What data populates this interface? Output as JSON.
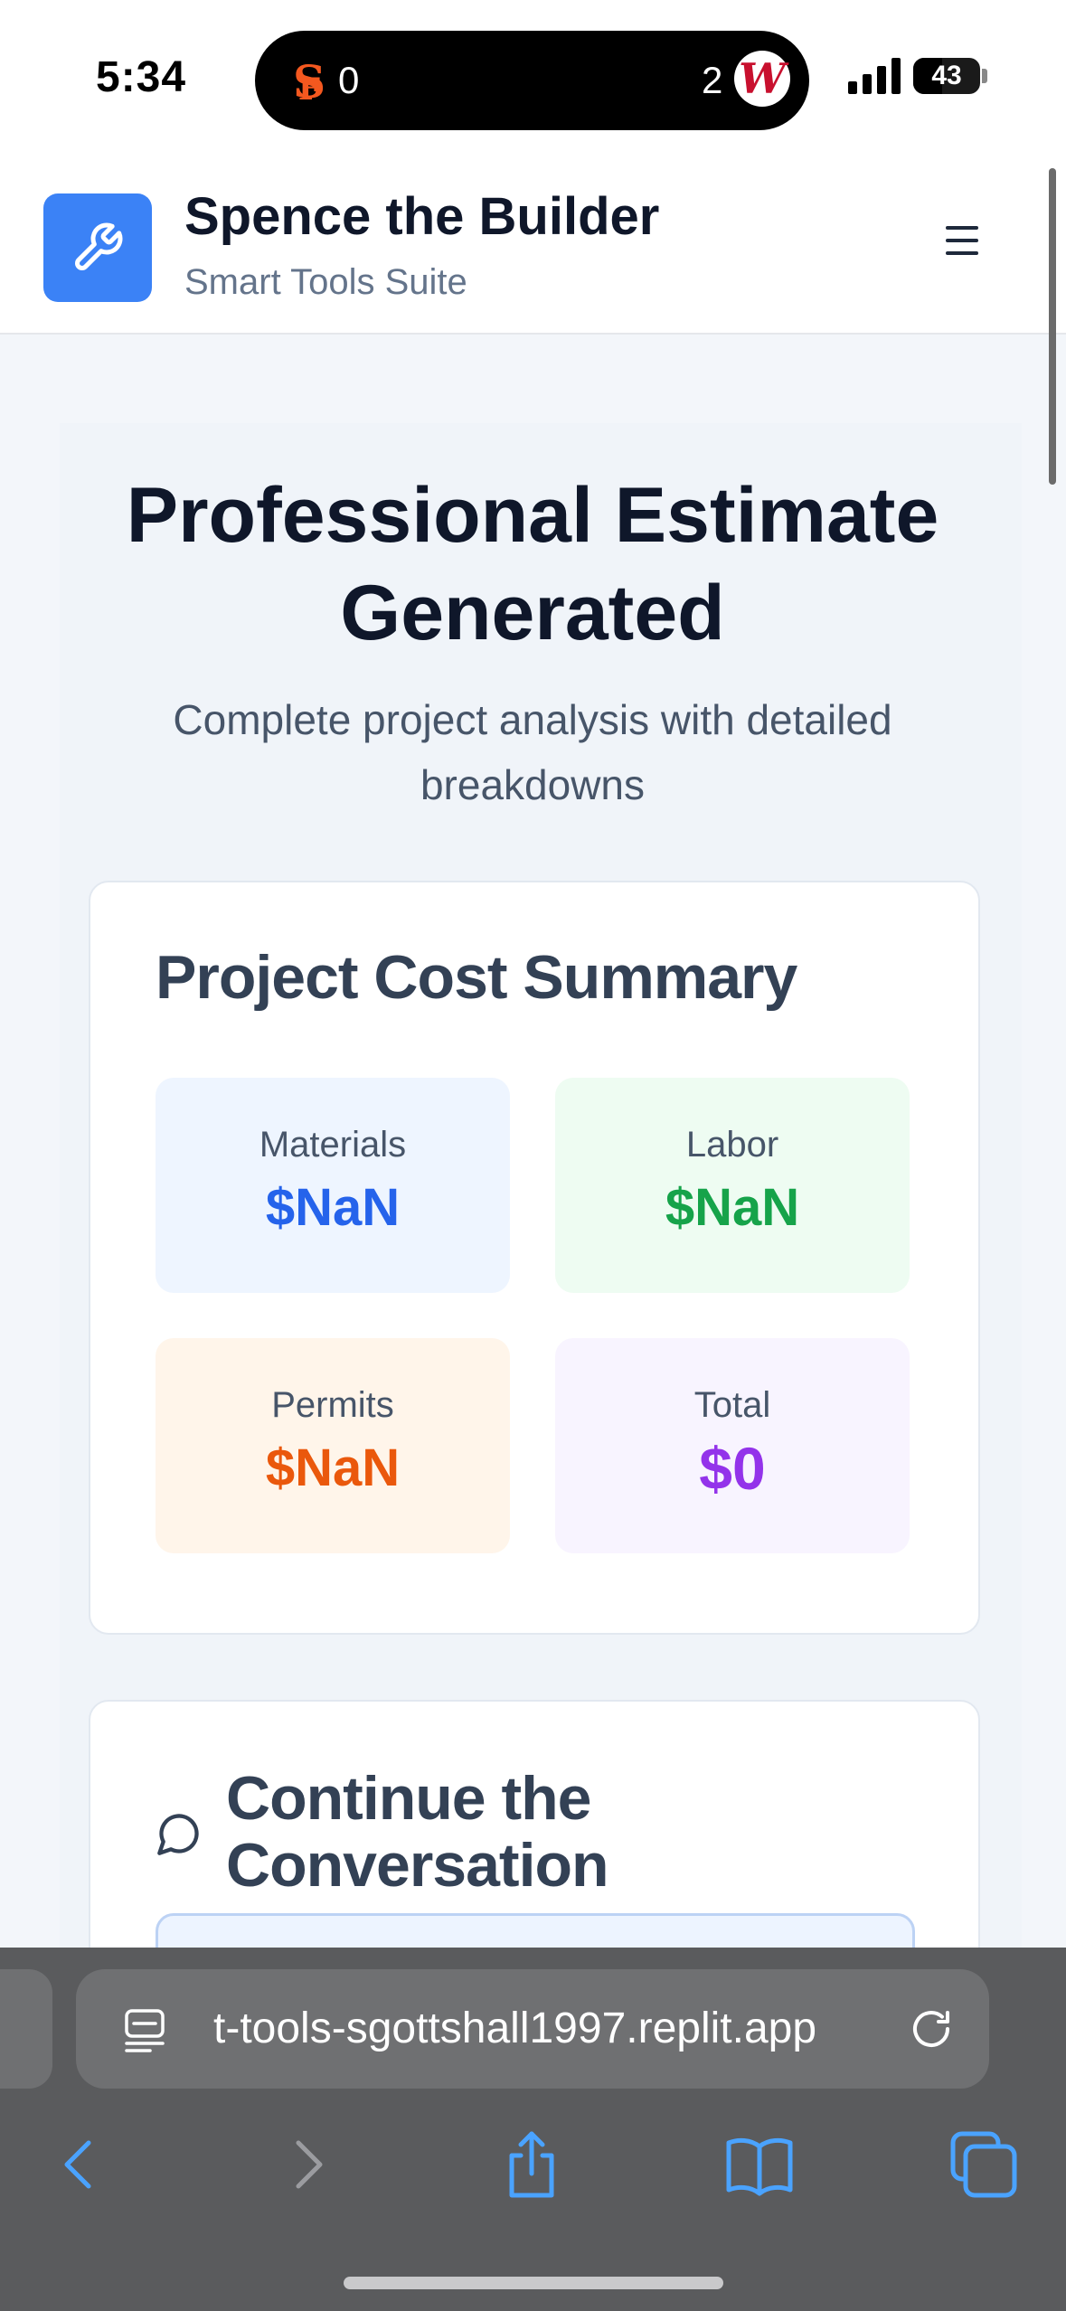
{
  "status_bar": {
    "time": "5:34",
    "live_activity": {
      "left_team_icon": "giants-logo-icon",
      "left_score": "0",
      "right_score": "2",
      "right_team_icon": "nationals-logo-icon"
    },
    "battery_level": "43"
  },
  "header": {
    "title": "Spence the Builder",
    "subtitle": "Smart Tools Suite",
    "logo_icon": "wrench-icon",
    "menu_icon": "hamburger-menu-icon",
    "accent_color": "#3b82f6"
  },
  "hero": {
    "title": "Professional Estimate Generated",
    "subtitle": "Complete project analysis with detailed breakdowns"
  },
  "summary": {
    "title": "Project Cost Summary",
    "tiles": [
      {
        "label": "Materials",
        "value": "$NaN",
        "color": "#2563eb"
      },
      {
        "label": "Labor",
        "value": "$NaN",
        "color": "#16a34a"
      },
      {
        "label": "Permits",
        "value": "$NaN",
        "color": "#ea580c"
      },
      {
        "label": "Total",
        "value": "$0",
        "color": "#9333ea"
      }
    ]
  },
  "conversation": {
    "title": "Continue the Conversation",
    "icon": "chat-bubble-icon"
  },
  "browser": {
    "url": "t-tools-sgottshall1997.replit.app",
    "buttons": [
      "back",
      "forward",
      "share",
      "bookmarks",
      "tabs"
    ]
  }
}
